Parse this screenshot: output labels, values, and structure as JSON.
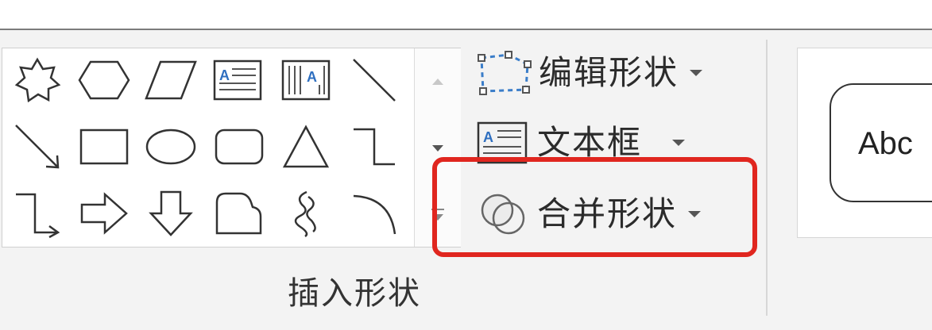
{
  "ribbon": {
    "group_label": "插入形状",
    "shapes": [
      "star-shape",
      "hexagon-shape",
      "parallelogram-shape",
      "horizontal-text-box-shape",
      "vertical-text-box-shape",
      "line-shape",
      "arrow-line-shape",
      "rectangle-shape",
      "oval-shape",
      "rounded-rectangle-shape",
      "triangle-shape",
      "elbow-connector-shape",
      "elbow-arrow-connector-shape",
      "right-arrow-shape",
      "down-arrow-shape",
      "snip-rectangle-shape",
      "freeform-scribble-shape",
      "arc-shape"
    ],
    "commands": {
      "edit_shape": "编辑形状",
      "text_box": "文本框",
      "merge_shapes": "合并形状"
    }
  },
  "shape_styles": {
    "preview_text": "Abc"
  },
  "colors": {
    "highlight": "#e0261f",
    "ribbon_bg": "#f3f3f3",
    "edit_point_blue": "#3a7dc9"
  }
}
